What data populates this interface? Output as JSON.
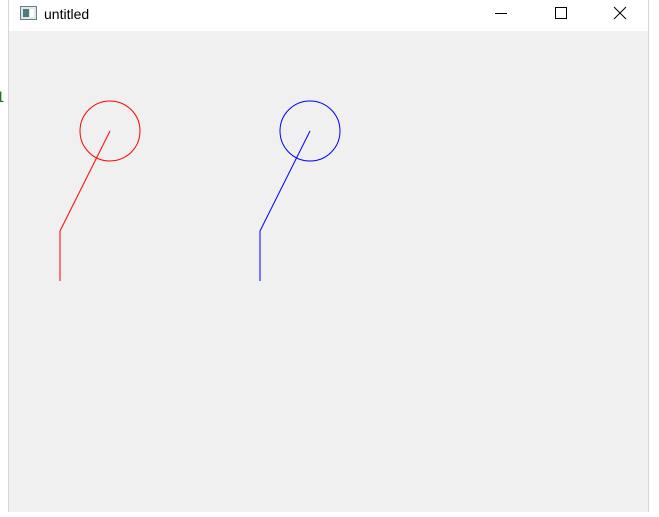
{
  "window": {
    "title": "untitled",
    "background": "#f0f0f0",
    "titlebar_background": "#ffffff",
    "icon": "app-window-icon",
    "controls": {
      "minimize_icon": "minimize-icon",
      "maximize_icon": "maximize-icon",
      "close_icon": "close-icon"
    }
  },
  "edge_text": "1",
  "figures": [
    {
      "name": "red-stick-figure",
      "color": "#ff0000"
    },
    {
      "name": "blue-stick-figure",
      "color": "#0000ff"
    }
  ]
}
